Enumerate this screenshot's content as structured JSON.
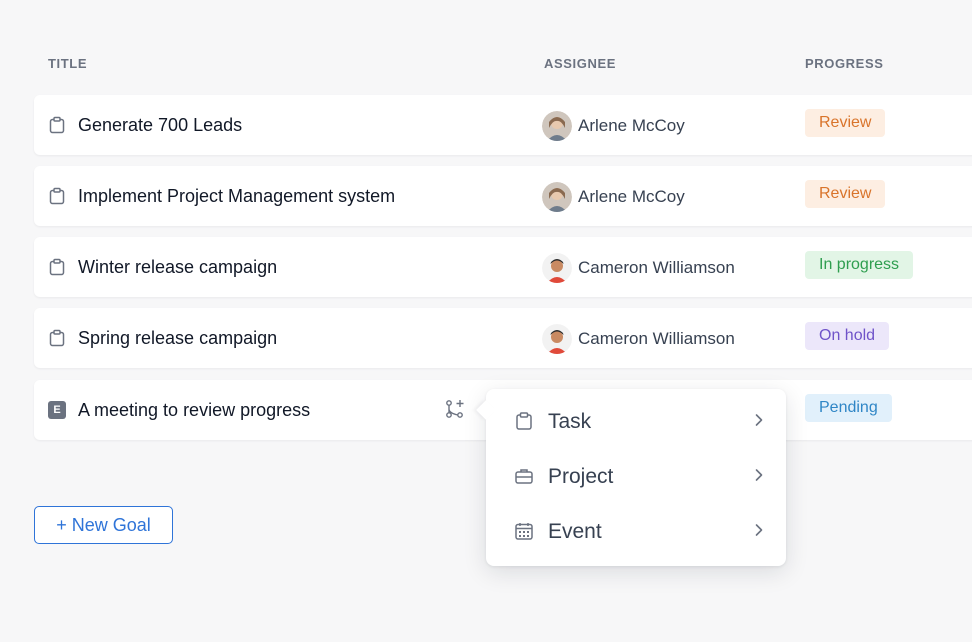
{
  "headers": {
    "title": "TITLE",
    "assignee": "ASSIGNEE",
    "progress": "PROGRESS"
  },
  "rows": [
    {
      "title": "Generate 700 Leads",
      "type_icon": "clipboard-icon",
      "assignee": "Arlene McCoy",
      "status": "Review"
    },
    {
      "title": "Implement Project Management system",
      "type_icon": "clipboard-icon",
      "assignee": "Arlene McCoy",
      "status": "Review"
    },
    {
      "title": "Winter release campaign",
      "type_icon": "clipboard-icon",
      "assignee": "Cameron Williamson",
      "status": "In progress"
    },
    {
      "title": "Spring release campaign",
      "type_icon": "clipboard-icon",
      "assignee": "Cameron Williamson",
      "status": "On hold"
    },
    {
      "title": "A meeting to review progress",
      "type_icon": "event-badge-icon",
      "type_badge": "E",
      "assignee": "",
      "status": "Pending"
    }
  ],
  "new_goal_label": "+ New Goal",
  "menu": {
    "items": [
      {
        "label": "Task",
        "icon": "clipboard-icon"
      },
      {
        "label": "Project",
        "icon": "briefcase-icon"
      },
      {
        "label": "Event",
        "icon": "calendar-icon"
      }
    ]
  },
  "colors": {
    "accent": "#2f74d8",
    "review": "#d9742b",
    "in_progress": "#2e9e4f",
    "on_hold": "#6f53c9",
    "pending": "#2f86c6"
  }
}
